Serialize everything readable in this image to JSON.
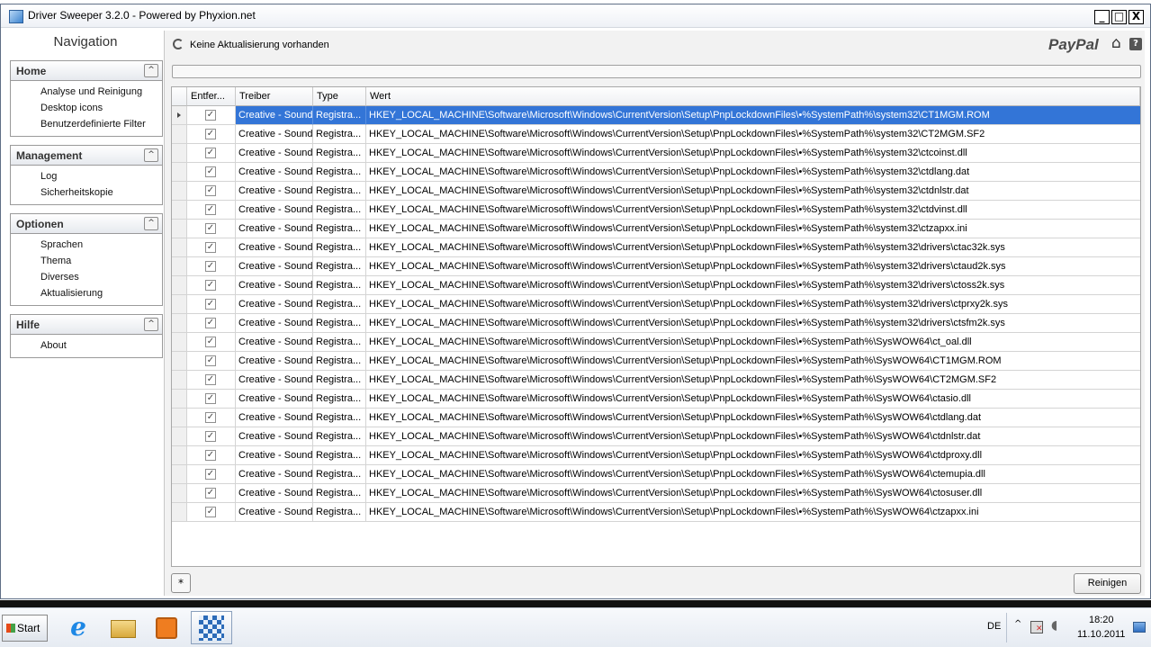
{
  "window": {
    "title": "Driver Sweeper 3.2.0 - Powered by Phyxion.net",
    "minimize": "_",
    "maximize": "□",
    "close": "X"
  },
  "sidebar": {
    "title": "Navigation",
    "collapse_glyph": "^",
    "groups": [
      {
        "title": "Home",
        "items": [
          "Analyse und Reinigung",
          "Desktop icons",
          "Benutzerdefinierte Filter"
        ]
      },
      {
        "title": "Management",
        "items": [
          "Log",
          "Sicherheitskopie"
        ]
      },
      {
        "title": "Optionen",
        "items": [
          "Sprachen",
          "Thema",
          "Diverses",
          "Aktualisierung"
        ]
      },
      {
        "title": "Hilfe",
        "items": [
          "About"
        ]
      }
    ]
  },
  "header": {
    "status": "Keine Aktualisierung vorhanden",
    "paypal": "PayPal",
    "home_icon": "⌂",
    "help_icon": "?",
    "progress": 0
  },
  "grid": {
    "columns": [
      "Entfer...",
      "Treiber",
      "Type",
      "Wert"
    ],
    "selected_index": 0,
    "rows": [
      {
        "checked": true,
        "driver": "Creative - Sound",
        "type": "Registra...",
        "value": "HKEY_LOCAL_MACHINE\\Software\\Microsoft\\Windows\\CurrentVersion\\Setup\\PnpLockdownFiles\\•%SystemPath%\\system32\\CT1MGM.ROM"
      },
      {
        "checked": true,
        "driver": "Creative - Sound",
        "type": "Registra...",
        "value": "HKEY_LOCAL_MACHINE\\Software\\Microsoft\\Windows\\CurrentVersion\\Setup\\PnpLockdownFiles\\•%SystemPath%\\system32\\CT2MGM.SF2"
      },
      {
        "checked": true,
        "driver": "Creative - Sound",
        "type": "Registra...",
        "value": "HKEY_LOCAL_MACHINE\\Software\\Microsoft\\Windows\\CurrentVersion\\Setup\\PnpLockdownFiles\\•%SystemPath%\\system32\\ctcoinst.dll"
      },
      {
        "checked": true,
        "driver": "Creative - Sound",
        "type": "Registra...",
        "value": "HKEY_LOCAL_MACHINE\\Software\\Microsoft\\Windows\\CurrentVersion\\Setup\\PnpLockdownFiles\\•%SystemPath%\\system32\\ctdlang.dat"
      },
      {
        "checked": true,
        "driver": "Creative - Sound",
        "type": "Registra...",
        "value": "HKEY_LOCAL_MACHINE\\Software\\Microsoft\\Windows\\CurrentVersion\\Setup\\PnpLockdownFiles\\•%SystemPath%\\system32\\ctdnlstr.dat"
      },
      {
        "checked": true,
        "driver": "Creative - Sound",
        "type": "Registra...",
        "value": "HKEY_LOCAL_MACHINE\\Software\\Microsoft\\Windows\\CurrentVersion\\Setup\\PnpLockdownFiles\\•%SystemPath%\\system32\\ctdvinst.dll"
      },
      {
        "checked": true,
        "driver": "Creative - Sound",
        "type": "Registra...",
        "value": "HKEY_LOCAL_MACHINE\\Software\\Microsoft\\Windows\\CurrentVersion\\Setup\\PnpLockdownFiles\\•%SystemPath%\\system32\\ctzapxx.ini"
      },
      {
        "checked": true,
        "driver": "Creative - Sound",
        "type": "Registra...",
        "value": "HKEY_LOCAL_MACHINE\\Software\\Microsoft\\Windows\\CurrentVersion\\Setup\\PnpLockdownFiles\\•%SystemPath%\\system32\\drivers\\ctac32k.sys"
      },
      {
        "checked": true,
        "driver": "Creative - Sound",
        "type": "Registra...",
        "value": "HKEY_LOCAL_MACHINE\\Software\\Microsoft\\Windows\\CurrentVersion\\Setup\\PnpLockdownFiles\\•%SystemPath%\\system32\\drivers\\ctaud2k.sys"
      },
      {
        "checked": true,
        "driver": "Creative - Sound",
        "type": "Registra...",
        "value": "HKEY_LOCAL_MACHINE\\Software\\Microsoft\\Windows\\CurrentVersion\\Setup\\PnpLockdownFiles\\•%SystemPath%\\system32\\drivers\\ctoss2k.sys"
      },
      {
        "checked": true,
        "driver": "Creative - Sound",
        "type": "Registra...",
        "value": "HKEY_LOCAL_MACHINE\\Software\\Microsoft\\Windows\\CurrentVersion\\Setup\\PnpLockdownFiles\\•%SystemPath%\\system32\\drivers\\ctprxy2k.sys"
      },
      {
        "checked": true,
        "driver": "Creative - Sound",
        "type": "Registra...",
        "value": "HKEY_LOCAL_MACHINE\\Software\\Microsoft\\Windows\\CurrentVersion\\Setup\\PnpLockdownFiles\\•%SystemPath%\\system32\\drivers\\ctsfm2k.sys"
      },
      {
        "checked": true,
        "driver": "Creative - Sound",
        "type": "Registra...",
        "value": "HKEY_LOCAL_MACHINE\\Software\\Microsoft\\Windows\\CurrentVersion\\Setup\\PnpLockdownFiles\\•%SystemPath%\\SysWOW64\\ct_oal.dll"
      },
      {
        "checked": true,
        "driver": "Creative - Sound",
        "type": "Registra...",
        "value": "HKEY_LOCAL_MACHINE\\Software\\Microsoft\\Windows\\CurrentVersion\\Setup\\PnpLockdownFiles\\•%SystemPath%\\SysWOW64\\CT1MGM.ROM"
      },
      {
        "checked": true,
        "driver": "Creative - Sound",
        "type": "Registra...",
        "value": "HKEY_LOCAL_MACHINE\\Software\\Microsoft\\Windows\\CurrentVersion\\Setup\\PnpLockdownFiles\\•%SystemPath%\\SysWOW64\\CT2MGM.SF2"
      },
      {
        "checked": true,
        "driver": "Creative - Sound",
        "type": "Registra...",
        "value": "HKEY_LOCAL_MACHINE\\Software\\Microsoft\\Windows\\CurrentVersion\\Setup\\PnpLockdownFiles\\•%SystemPath%\\SysWOW64\\ctasio.dll"
      },
      {
        "checked": true,
        "driver": "Creative - Sound",
        "type": "Registra...",
        "value": "HKEY_LOCAL_MACHINE\\Software\\Microsoft\\Windows\\CurrentVersion\\Setup\\PnpLockdownFiles\\•%SystemPath%\\SysWOW64\\ctdlang.dat"
      },
      {
        "checked": true,
        "driver": "Creative - Sound",
        "type": "Registra...",
        "value": "HKEY_LOCAL_MACHINE\\Software\\Microsoft\\Windows\\CurrentVersion\\Setup\\PnpLockdownFiles\\•%SystemPath%\\SysWOW64\\ctdnlstr.dat"
      },
      {
        "checked": true,
        "driver": "Creative - Sound",
        "type": "Registra...",
        "value": "HKEY_LOCAL_MACHINE\\Software\\Microsoft\\Windows\\CurrentVersion\\Setup\\PnpLockdownFiles\\•%SystemPath%\\SysWOW64\\ctdproxy.dll"
      },
      {
        "checked": true,
        "driver": "Creative - Sound",
        "type": "Registra...",
        "value": "HKEY_LOCAL_MACHINE\\Software\\Microsoft\\Windows\\CurrentVersion\\Setup\\PnpLockdownFiles\\•%SystemPath%\\SysWOW64\\ctemupia.dll"
      },
      {
        "checked": true,
        "driver": "Creative - Sound",
        "type": "Registra...",
        "value": "HKEY_LOCAL_MACHINE\\Software\\Microsoft\\Windows\\CurrentVersion\\Setup\\PnpLockdownFiles\\•%SystemPath%\\SysWOW64\\ctosuser.dll"
      },
      {
        "checked": true,
        "driver": "Creative - Sound",
        "type": "Registra...",
        "value": "HKEY_LOCAL_MACHINE\\Software\\Microsoft\\Windows\\CurrentVersion\\Setup\\PnpLockdownFiles\\•%SystemPath%\\SysWOW64\\ctzapxx.ini"
      }
    ]
  },
  "footer": {
    "filter_button": "*",
    "clean_button": "Reinigen"
  },
  "taskbar": {
    "start": "Start",
    "ie_glyph": "e",
    "language": "DE",
    "tray_chevron": "^",
    "volume_glyph": "◖",
    "time": "18:20",
    "date": "11.10.2011",
    "icons": [
      "internet-explorer-icon",
      "windows-explorer-icon",
      "media-player-icon",
      "driver-sweeper-icon"
    ]
  }
}
